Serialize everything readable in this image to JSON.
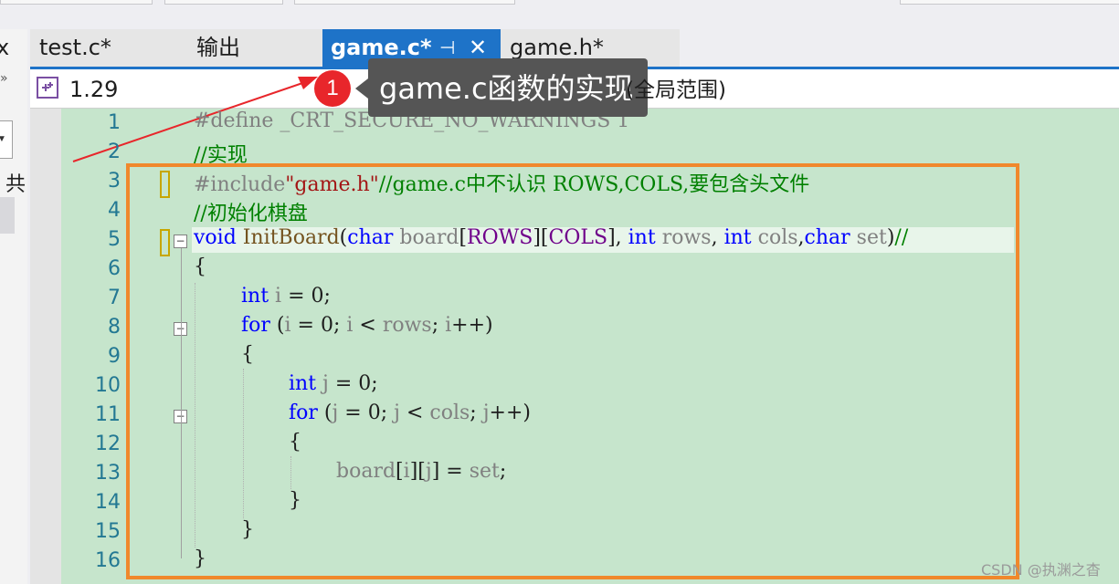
{
  "tabs": [
    {
      "label": "test.c*",
      "active": false
    },
    {
      "label": "输出",
      "active": false
    },
    {
      "label": "game.c*",
      "active": true
    },
    {
      "label": "game.h*",
      "active": false
    }
  ],
  "active_tab_icons": [
    "pin-icon",
    "close-icon"
  ],
  "sidebar": {
    "fragment_top": "x",
    "fragment_mid": "共"
  },
  "navbar": {
    "project": "1.29"
  },
  "annotation": {
    "badge_number": "1",
    "callout_text": "game.c函数的实现",
    "callout_suffix": "(全局范围)"
  },
  "editor": {
    "line_numbers": [
      "1",
      "2",
      "3",
      "4",
      "5",
      "6",
      "7",
      "8",
      "9",
      "10",
      "11",
      "12",
      "13",
      "14",
      "15",
      "16"
    ],
    "lines": [
      {
        "n": 1,
        "text": "#define _CRT_SECURE_NO_WARNINGS 1"
      },
      {
        "n": 2,
        "text": "//实现"
      },
      {
        "n": 3,
        "text": "#include\"game.h\"//game.c中不认识 ROWS,COLS,要包含头文件"
      },
      {
        "n": 4,
        "text": "//初始化棋盘"
      },
      {
        "n": 5,
        "text": "void InitBoard(char board[ROWS][COLS], int rows, int cols,char set)//"
      },
      {
        "n": 6,
        "text": "{"
      },
      {
        "n": 7,
        "text": "int i = 0;"
      },
      {
        "n": 8,
        "text": "for (i = 0; i < rows; i++)"
      },
      {
        "n": 9,
        "text": "{"
      },
      {
        "n": 10,
        "text": "int j = 0;"
      },
      {
        "n": 11,
        "text": "for (j = 0; j < cols; j++)"
      },
      {
        "n": 12,
        "text": "{"
      },
      {
        "n": 13,
        "text": "board[i][j] = set;"
      },
      {
        "n": 14,
        "text": "}"
      },
      {
        "n": 15,
        "text": "}"
      },
      {
        "n": 16,
        "text": "}"
      }
    ]
  },
  "watermark": "CSDN @执渊之杳",
  "colors": {
    "tab_active": "#1e73c8",
    "editor_bg": "#c6e5cc",
    "highlight_border": "#f0882c",
    "badge": "#e8262b",
    "callout_bg": "#555555"
  }
}
